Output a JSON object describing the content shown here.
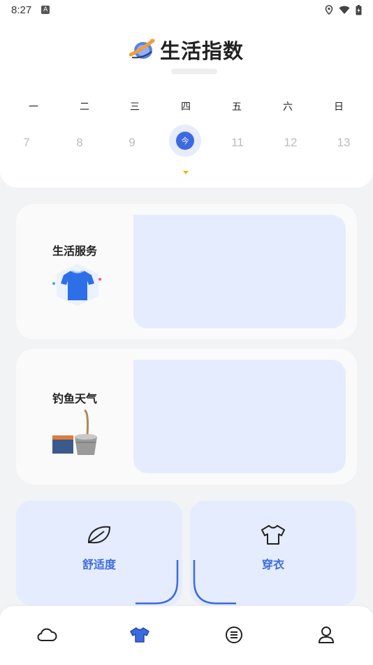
{
  "status_bar": {
    "time": "8:27",
    "badge": "A"
  },
  "header": {
    "title": "生活指数"
  },
  "calendar": {
    "weekdays": [
      "一",
      "二",
      "三",
      "四",
      "五",
      "六",
      "日"
    ],
    "dates": [
      "7",
      "8",
      "9",
      "今",
      "11",
      "12",
      "13"
    ],
    "today_label": "今"
  },
  "services": [
    {
      "label": "生活服务"
    },
    {
      "label": "钓鱼天气"
    }
  ],
  "quick_cards": [
    {
      "label": "舒适度",
      "icon": "leaf-icon"
    },
    {
      "label": "穿衣",
      "icon": "shirt-icon"
    }
  ],
  "bottom_nav": [
    {
      "name": "weather",
      "icon": "cloud-icon"
    },
    {
      "name": "clothing",
      "icon": "shirt-icon",
      "active": true
    },
    {
      "name": "list",
      "icon": "list-icon"
    },
    {
      "name": "profile",
      "icon": "user-icon"
    }
  ],
  "colors": {
    "accent": "#3c6ae0",
    "panel": "#e5ecfd",
    "caret": "#f0b400"
  }
}
